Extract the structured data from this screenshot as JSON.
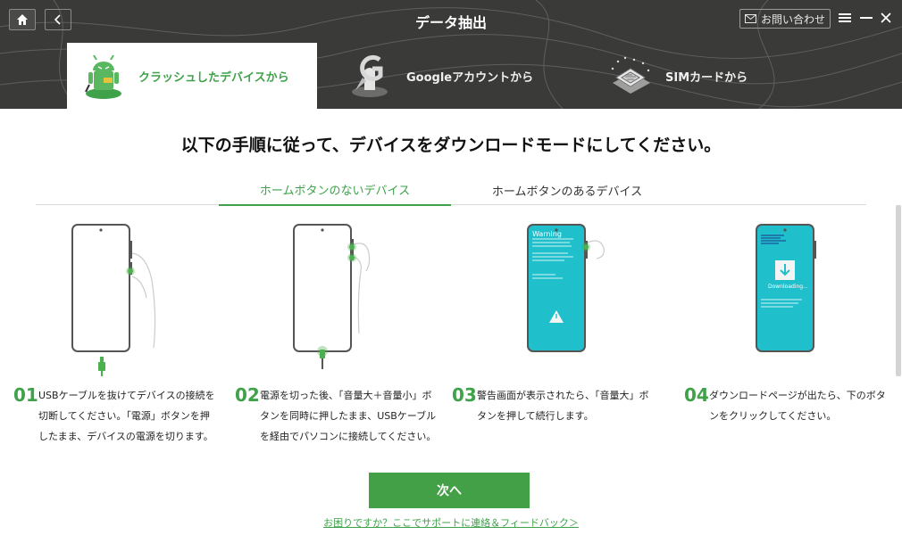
{
  "window": {
    "title": "データ抽出",
    "contact_label": "お問い合わせ"
  },
  "modes": [
    {
      "label": "クラッシュしたデバイスから",
      "icon": "crashed-android-icon",
      "active": true
    },
    {
      "label": "Googleアカウントから",
      "icon": "google-account-icon",
      "active": false
    },
    {
      "label": "SIMカードから",
      "icon": "sim-card-icon",
      "active": false
    }
  ],
  "main": {
    "heading": "以下の手順に従って、デバイスをダウンロードモードにしてください。",
    "subtabs": [
      {
        "label": "ホームボタンのないデバイス",
        "active": true
      },
      {
        "label": "ホームボタンのあるデバイス",
        "active": false
      }
    ],
    "steps": [
      {
        "num": "01",
        "text": "USBケーブルを抜けてデバイスの接続を切断してください。「電源」ボタンを押したまま、デバイスの電源を切ります。"
      },
      {
        "num": "02",
        "text": "電源を切った後、「音量大＋音量小」ボタンを同時に押したまま、USBケーブルを経由でパソコンに接続してください。"
      },
      {
        "num": "03",
        "text": "警告画面が表示されたら、「音量大」ボタンを押して続行します。"
      },
      {
        "num": "04",
        "text": "ダウンロードページが出たら、下のボタンをクリックしてください。"
      }
    ],
    "screen_texts": {
      "warning": "Warning",
      "downloading": "Downloading..."
    },
    "next_label": "次へ",
    "help_link": "お困りですか？ここでサポートに連絡＆フィードバック＞"
  },
  "colors": {
    "accent": "#3fa24a",
    "header_bg": "#3a3b39",
    "screen_teal": "#1fbfcc"
  }
}
